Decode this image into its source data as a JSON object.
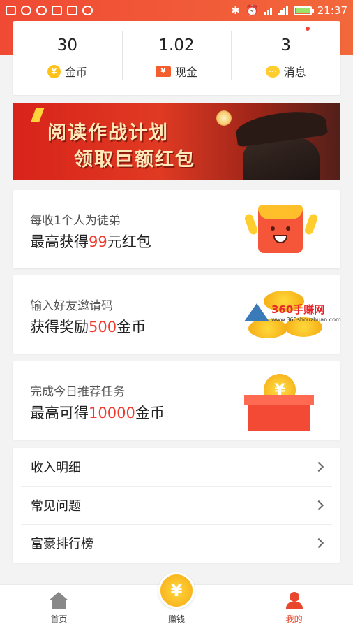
{
  "status_bar": {
    "time": "21:37",
    "battery_level": 0.9
  },
  "stats": [
    {
      "value": "30",
      "label": "金币",
      "icon": "coin-icon"
    },
    {
      "value": "1.02",
      "label": "现金",
      "icon": "cash-icon"
    },
    {
      "value": "3",
      "label": "消息",
      "icon": "message-icon"
    }
  ],
  "banner": {
    "line1": "阅读作战计划",
    "line2": "领取巨额红包"
  },
  "promos": [
    {
      "sub": "每收1个人为徒弟",
      "pre": "最高获得",
      "highlight": "99",
      "post": "元红包"
    },
    {
      "sub": "输入好友邀请码",
      "pre": "获得奖励",
      "highlight": "500",
      "post": "金币"
    },
    {
      "sub": "完成今日推荐任务",
      "pre": "最高可得",
      "highlight": "10000",
      "post": "金币"
    }
  ],
  "watermark": {
    "name": "360手赚网",
    "url": "www.360shouzhuan.com"
  },
  "menu": [
    {
      "label": "收入明细"
    },
    {
      "label": "常见问题"
    },
    {
      "label": "富豪排行榜"
    }
  ],
  "nav": [
    {
      "label": "首页"
    },
    {
      "label": "赚钱"
    },
    {
      "label": "我的"
    }
  ],
  "glyphs": {
    "yuan": "¥"
  },
  "colors": {
    "accent": "#f04a34",
    "highlight": "#f03a2e",
    "coin": "#ffc21b"
  }
}
